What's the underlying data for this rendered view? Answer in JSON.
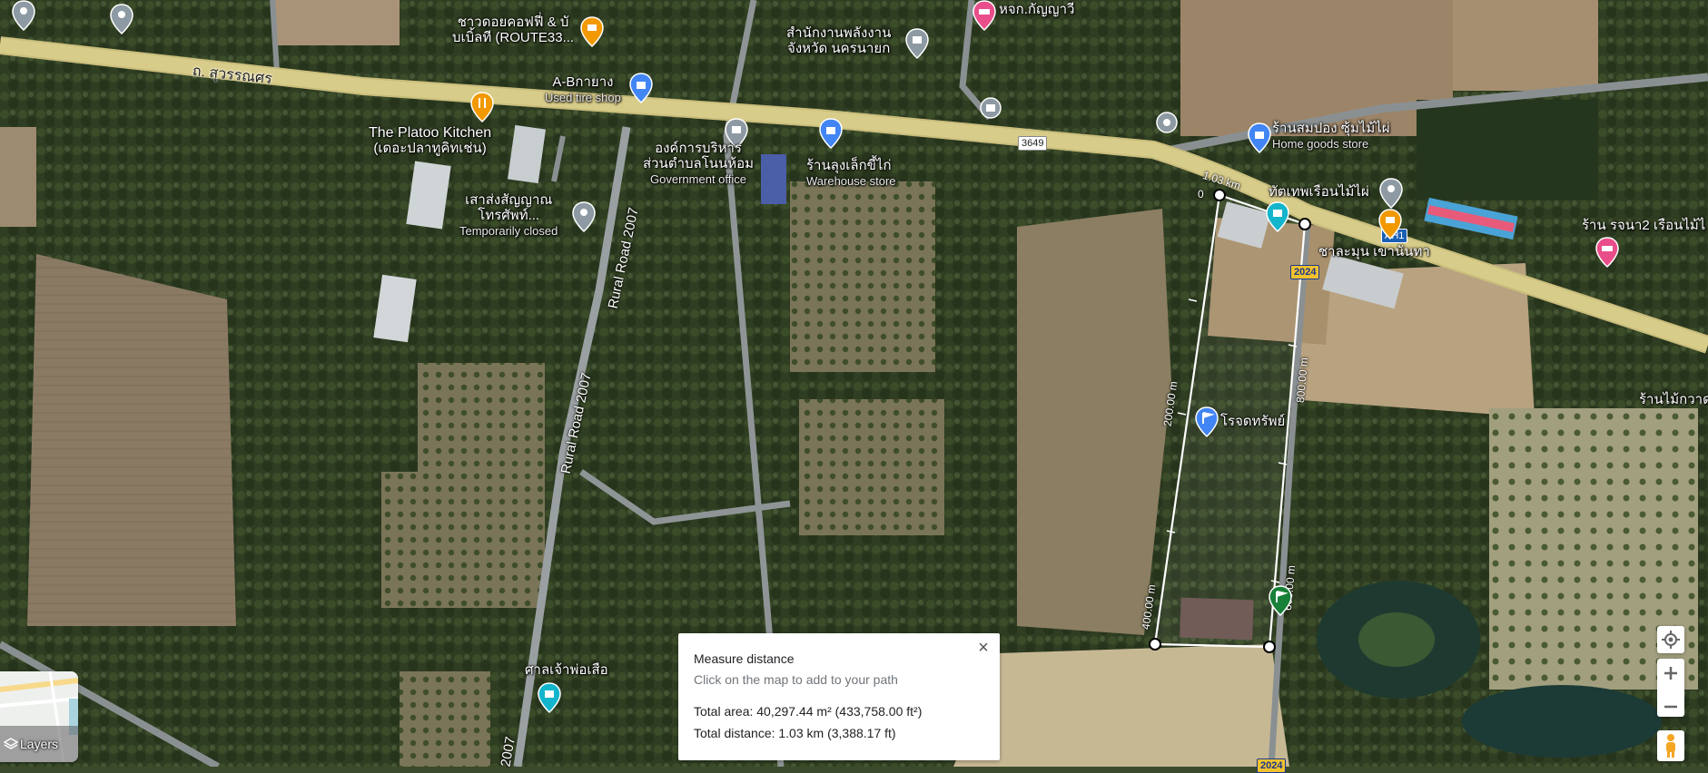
{
  "roads": {
    "main_road": "ถ. สุวรรณศร",
    "rural_road_a": "Rural Road 2007",
    "rural_road_b": "Rural Road 2007",
    "rural_road_c": "2007",
    "shield_3649": "3649",
    "shield_ah1": "AH1",
    "shield_2024_a": "2024",
    "shield_2024_b": "2024"
  },
  "places": [
    {
      "name": "ชาวดอยคอฟฟี่ & บั",
      "name2": "บเบิ้ลที (ROUTE33...",
      "sub": ""
    },
    {
      "name": "A-Bกายาง",
      "name2": "",
      "sub": "Used tire shop"
    },
    {
      "name": "The Platoo Kitchen",
      "name2": "(เดอะปลาทูคิทเช่น)",
      "sub": ""
    },
    {
      "name": "สำนักงานพลังงาน",
      "name2": "จังหวัด นครนายก",
      "sub": ""
    },
    {
      "name": "หจก.กัญญาวี",
      "name2": "",
      "sub": ""
    },
    {
      "name": "องค์การบริหาร",
      "name2": "ส่วนตำบลโนนห้อม",
      "sub": "Government office"
    },
    {
      "name": "ร้านลุงเล็กขี้ไก่",
      "name2": "",
      "sub": "Warehouse store"
    },
    {
      "name": "เสาส่งสัญญาณ",
      "name2": "โทรศัพท์...",
      "sub": "Temporarily closed"
    },
    {
      "name": "ร้านสมปอง ซุ้มไม้ไผ่",
      "name2": "",
      "sub": "Home goods store"
    },
    {
      "name": "ทัตเทพเรือนไม้ไผ่",
      "name2": "",
      "sub": ""
    },
    {
      "name": "ชาละมุน เขานันทา",
      "name2": "",
      "sub": ""
    },
    {
      "name": "ร้าน รจนา2 เรือนไม้ไ",
      "name2": "",
      "sub": ""
    },
    {
      "name": "ร้านไม้กวาด",
      "name2": "",
      "sub": ""
    },
    {
      "name": "โรจดทรัพย์",
      "name2": "",
      "sub": ""
    },
    {
      "name": "ศาลเจ้าพ่อเสือ",
      "name2": "",
      "sub": ""
    }
  ],
  "measure_labels": {
    "zero": "0",
    "seg_top": "1.03 km",
    "seg_200": "200.00 m",
    "seg_400": "400.00 m",
    "seg_600": "600.00 m",
    "seg_800": "800.00 m"
  },
  "panel": {
    "title": "Measure distance",
    "hint": "Click on the map to add to your path",
    "area": "Total area: 40,297.44 m² (433,758.00 ft²)",
    "distance": "Total distance: 1.03 km (3,388.17 ft)",
    "close": "×"
  },
  "layers": {
    "label": "Layers"
  },
  "colors": {
    "main_road": "#d8cc8a",
    "secondary_road": "#9aa0a2",
    "measure_line": "#ffffff",
    "pin_blue": "#4285f4",
    "pin_orange": "#f29900",
    "pin_gray": "#8e9aa3",
    "pin_pink": "#e94d8a",
    "pin_teal": "#12b5cb",
    "pin_green": "#188038"
  },
  "icons": [
    "locate-icon",
    "zoom-in-icon",
    "zoom-out-icon",
    "pegman-icon",
    "layers-icon",
    "close-icon"
  ]
}
